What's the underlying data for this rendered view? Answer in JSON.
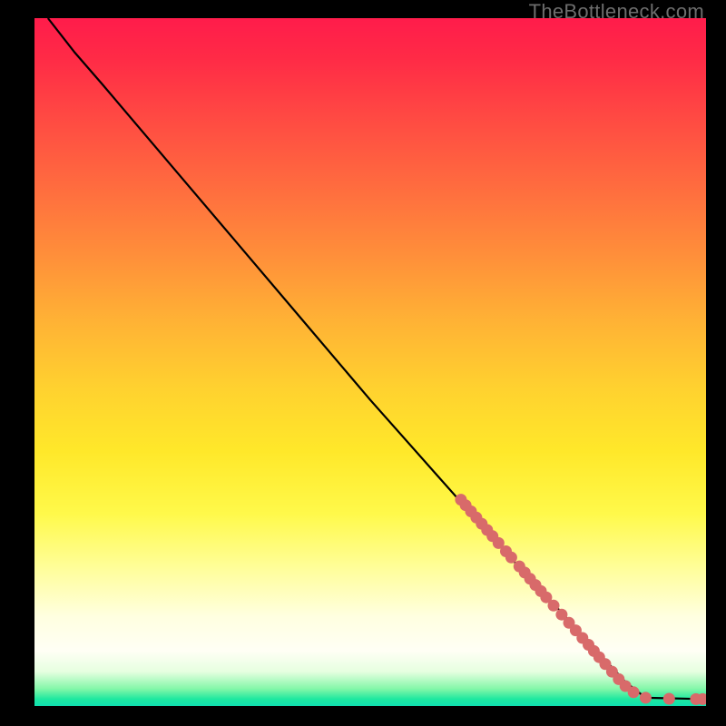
{
  "watermark": "TheBottleneck.com",
  "colors": {
    "dot": "#d86a6a",
    "line": "#000000",
    "gradient_top": "#ff1c4b",
    "gradient_bottom": "#0fdfb0"
  },
  "chart_data": {
    "type": "line",
    "title": "",
    "xlabel": "",
    "ylabel": "",
    "xlim": [
      0,
      100
    ],
    "ylim": [
      0,
      100
    ],
    "line_points": [
      {
        "x": 2,
        "y": 100
      },
      {
        "x": 6,
        "y": 95
      },
      {
        "x": 10,
        "y": 90.5
      },
      {
        "x": 20,
        "y": 79
      },
      {
        "x": 30,
        "y": 67.5
      },
      {
        "x": 40,
        "y": 56
      },
      {
        "x": 50,
        "y": 44.5
      },
      {
        "x": 60,
        "y": 33.5
      },
      {
        "x": 70,
        "y": 22.5
      },
      {
        "x": 80,
        "y": 12
      },
      {
        "x": 88,
        "y": 3.5
      },
      {
        "x": 91,
        "y": 1.2
      },
      {
        "x": 100,
        "y": 1.0
      }
    ],
    "series": [
      {
        "name": "cluster-points",
        "values": [
          {
            "x": 63.5,
            "y": 30.0
          },
          {
            "x": 64.2,
            "y": 29.2
          },
          {
            "x": 65.0,
            "y": 28.3
          },
          {
            "x": 65.8,
            "y": 27.4
          },
          {
            "x": 66.6,
            "y": 26.5
          },
          {
            "x": 67.4,
            "y": 25.6
          },
          {
            "x": 68.2,
            "y": 24.7
          },
          {
            "x": 69.1,
            "y": 23.7
          },
          {
            "x": 70.2,
            "y": 22.5
          },
          {
            "x": 71.0,
            "y": 21.6
          },
          {
            "x": 72.2,
            "y": 20.3
          },
          {
            "x": 73.0,
            "y": 19.4
          },
          {
            "x": 73.8,
            "y": 18.5
          },
          {
            "x": 74.6,
            "y": 17.6
          },
          {
            "x": 75.4,
            "y": 16.7
          },
          {
            "x": 76.2,
            "y": 15.8
          },
          {
            "x": 77.3,
            "y": 14.6
          },
          {
            "x": 78.5,
            "y": 13.3
          },
          {
            "x": 79.6,
            "y": 12.1
          },
          {
            "x": 80.6,
            "y": 11.0
          },
          {
            "x": 81.6,
            "y": 9.9
          },
          {
            "x": 82.5,
            "y": 8.9
          },
          {
            "x": 83.3,
            "y": 8.0
          },
          {
            "x": 84.1,
            "y": 7.1
          },
          {
            "x": 85.0,
            "y": 6.1
          },
          {
            "x": 86.0,
            "y": 5.0
          },
          {
            "x": 87.0,
            "y": 3.9
          },
          {
            "x": 88.0,
            "y": 2.9
          },
          {
            "x": 89.2,
            "y": 2.0
          },
          {
            "x": 91.0,
            "y": 1.2
          },
          {
            "x": 94.5,
            "y": 1.05
          },
          {
            "x": 98.5,
            "y": 1.0
          },
          {
            "x": 99.5,
            "y": 1.0
          }
        ]
      }
    ]
  }
}
